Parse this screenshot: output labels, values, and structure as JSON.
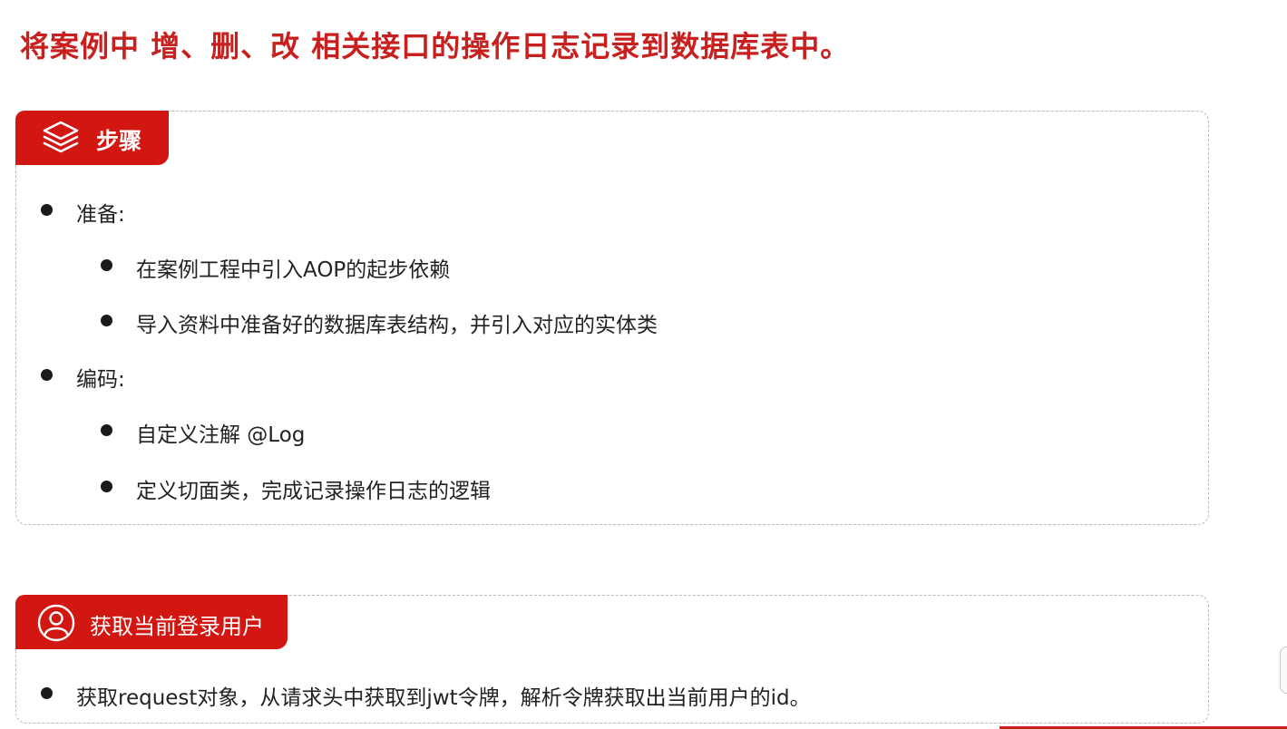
{
  "title": "将案例中 增、删、改 相关接口的操作日志记录到数据库表中。",
  "steps_card": {
    "tag_label": "步骤",
    "tag_icon": "layers-icon",
    "items": [
      {
        "text": "准备:",
        "level": 1
      },
      {
        "text": "在案例工程中引入AOP的起步依赖",
        "level": 2
      },
      {
        "text": "导入资料中准备好的数据库表结构，并引入对应的实体类",
        "level": 2
      },
      {
        "text": "编码:",
        "level": 1
      },
      {
        "text": "自定义注解 @Log",
        "level": 2
      },
      {
        "text": "定义切面类，完成记录操作日志的逻辑",
        "level": 2
      }
    ]
  },
  "user_card": {
    "tag_label": "获取当前登录用户",
    "tag_icon": "user-icon",
    "items": [
      {
        "text": "获取request对象，从请求头中获取到jwt令牌，解析令牌获取出当前用户的id。",
        "level": 1
      }
    ]
  },
  "colors": {
    "accent": "#d21712",
    "title": "#c8201e"
  }
}
